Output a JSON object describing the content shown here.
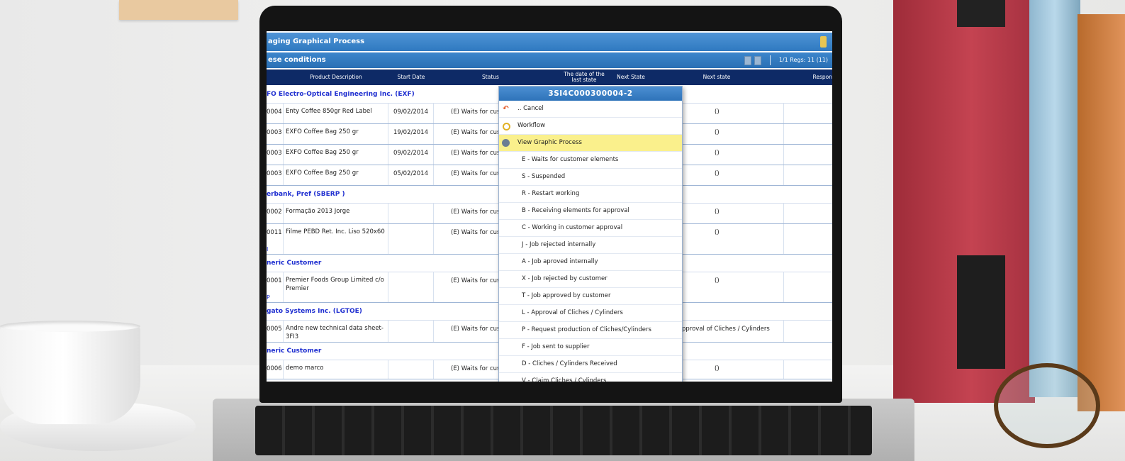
{
  "app": {
    "title": "aging Graphical Process",
    "filter_label": "ese conditions",
    "pager_text": "1/1 Regs: 11 (11)"
  },
  "table": {
    "headers": {
      "product_description": "Product Description",
      "start_date": "Start Date",
      "status": "Status",
      "last_state_date": "The date of the last state",
      "next_state_short": "Next State",
      "next_state": "Next state",
      "responsible": "Respon"
    },
    "groups": [
      {
        "name": "FO Electro-Optical Engineering Inc. (EXF)",
        "rows": [
          {
            "code": "0004",
            "description": "Enty Coffee 850gr Red Label",
            "start_date": "09/02/2014",
            "status": "(E) Waits for cus",
            "next_state": "()",
            "tag": ""
          },
          {
            "code": "0003",
            "description": "EXFO Coffee Bag 250 gr",
            "start_date": "19/02/2014",
            "status": "(E) Waits for cus",
            "next_state": "()",
            "tag": ""
          },
          {
            "code": "0003",
            "description": "EXFO Coffee Bag 250 gr",
            "start_date": "09/02/2014",
            "status": "(E) Waits for cus",
            "next_state": "()",
            "tag": ""
          },
          {
            "code": "0003",
            "description": "EXFO Coffee Bag 250 gr",
            "start_date": "05/02/2014",
            "status": "(E) Waits for cus",
            "next_state": "()",
            "tag": ""
          }
        ]
      },
      {
        "name": "erbank, Pref (SBERP )",
        "rows": [
          {
            "code": "0002",
            "description": "Formação 2013 Jorge",
            "start_date": "",
            "status": "(E) Waits for cus",
            "next_state": "()",
            "tag": ""
          },
          {
            "code": "0011",
            "description": "Filme PEBD Ret. Inc. Liso 520x60",
            "start_date": "",
            "status": "(E) Waits for cus",
            "next_state": "()",
            "tag": "I"
          }
        ]
      },
      {
        "name": "neric Customer",
        "rows": [
          {
            "code": "0001",
            "description": "Premier Foods Group Limited c/o Premier",
            "start_date": "",
            "status": "(E) Waits for cus",
            "next_state": "()",
            "tag": "P"
          }
        ]
      },
      {
        "name": "gato Systems Inc. (LGTOE)",
        "rows": [
          {
            "code": "0005",
            "description": "Andre new technical data sheet-3FI3",
            "start_date": "",
            "status": "(E) Waits for cus",
            "next_state": "pproval of Cliches / Cylinders",
            "tag": ""
          }
        ]
      },
      {
        "name": "neric Customer",
        "rows": [
          {
            "code": "0006",
            "description": "demo marco",
            "start_date": "",
            "status": "(E) Waits for cus",
            "next_state": "()",
            "tag": ""
          }
        ]
      }
    ]
  },
  "context_menu": {
    "title": "3SI4C000300004-2",
    "actions": [
      {
        "label": ".. Cancel",
        "icon": "cancel-icon"
      },
      {
        "label": "Workflow",
        "icon": "workflow-icon"
      },
      {
        "label": "View Graphic Process",
        "icon": "view-process-icon"
      }
    ],
    "states": [
      "E - Waits for customer elements",
      "S - Suspended",
      "R - Restart working",
      "B - Receiving elements for approval",
      "C - Working in customer approval",
      "J - Job rejected internally",
      "A - Job aproved internally",
      "X - Job rejected by customer",
      "T - Job approved by customer",
      "L - Approval of Cliches / Cylinders",
      "P - Request production of Cliches/Cylinders",
      "F - Job sent to supplier",
      "D - Cliches / Cylinders Received",
      "V - Claim Cliches / Cylinders"
    ]
  }
}
